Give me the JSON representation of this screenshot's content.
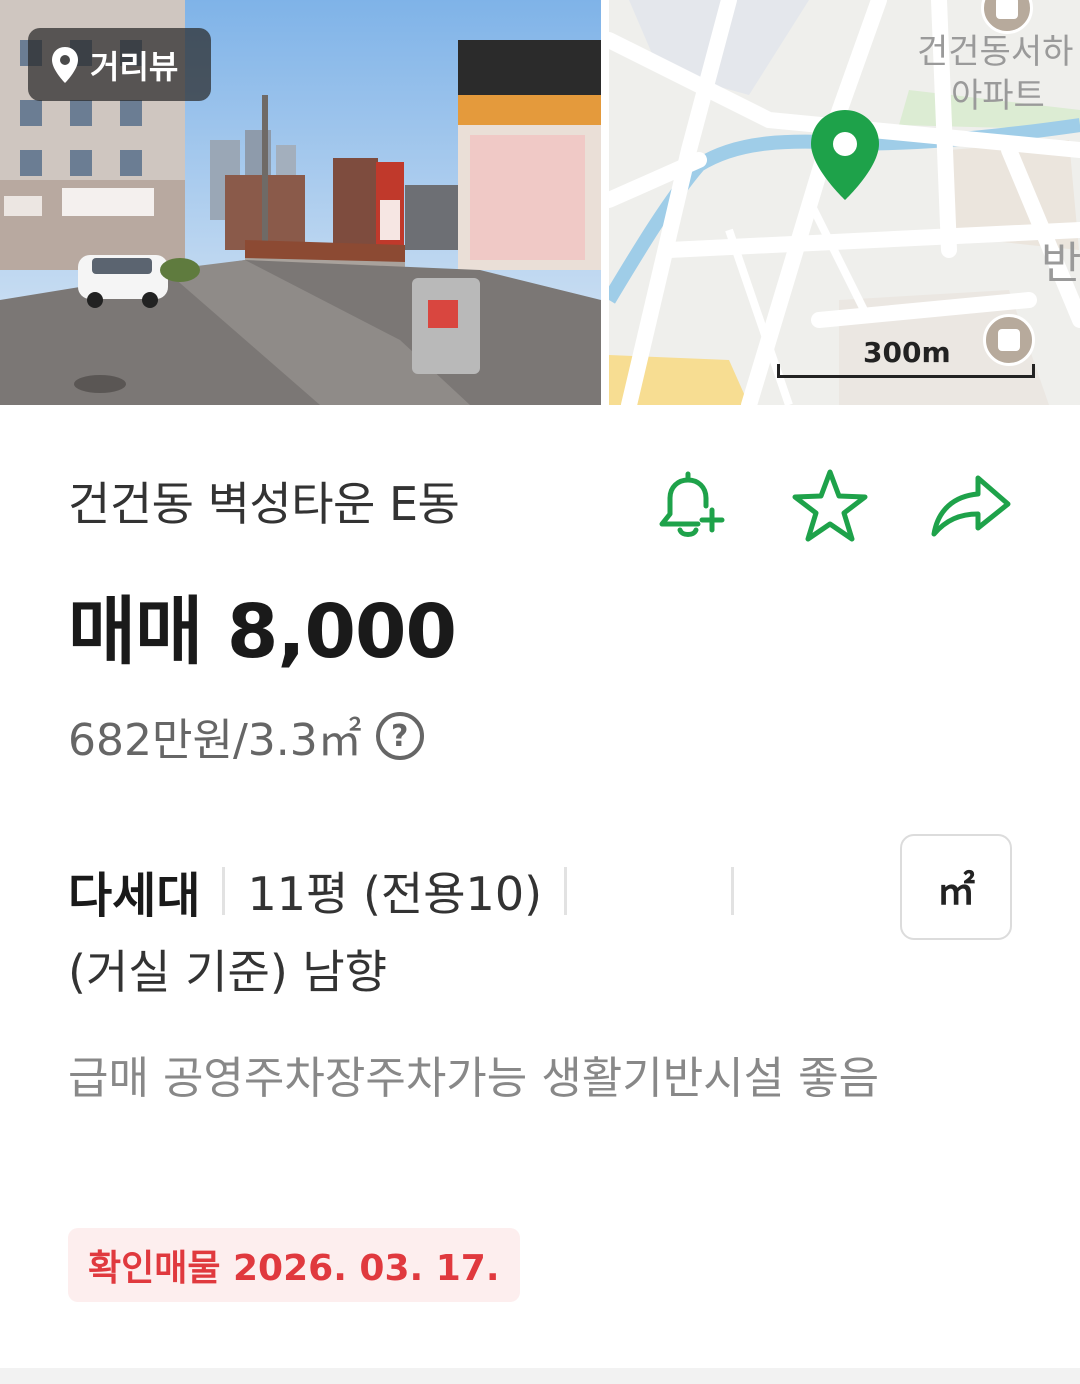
{
  "hero": {
    "streetview_label": "거리뷰",
    "map": {
      "labels": [
        "건건동서하",
        "아파트",
        "반"
      ],
      "scale": "300m",
      "pin_color": "#1ea24a"
    }
  },
  "listing": {
    "title": "건건동 벽성타운 E동",
    "price": "매매 8,000",
    "unit_price": "682만원/3.3㎡",
    "help": "?",
    "property_type": "다세대",
    "area": "11평 (전용10)",
    "direction": "(거실 기준) 남향",
    "unit_toggle": "㎡",
    "description": "급매 공영주차장주차가능 생활기반시설 좋음",
    "confirm_badge": "확인매물 2026. 03. 17."
  },
  "actions": [
    {
      "icon": "bell-plus-icon"
    },
    {
      "icon": "star-icon"
    },
    {
      "icon": "share-icon"
    }
  ],
  "colors": {
    "accent": "#1ea24a",
    "badge_text": "#e0393e",
    "badge_bg": "#fdeeee"
  }
}
